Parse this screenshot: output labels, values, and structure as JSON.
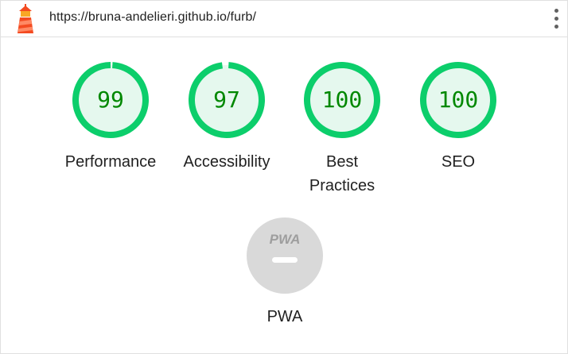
{
  "header": {
    "url": "https://bruna-andelieri.github.io/furb/",
    "logo_icon": "lighthouse-icon",
    "menu_icon": "kebab-menu-icon"
  },
  "colors": {
    "pass": "#0cce6b",
    "pass_fill": "#e5f8ee",
    "pass_text": "#008800",
    "pwa_gray": "#d9d9d9",
    "lighthouse_red": "#f44b21",
    "lighthouse_orange": "#f9a825"
  },
  "categories": [
    {
      "name": "performance",
      "score": "99",
      "value": 99,
      "label": "Performance"
    },
    {
      "name": "accessibility",
      "score": "97",
      "value": 97,
      "label": "Accessibility"
    },
    {
      "name": "best-practices",
      "score": "100",
      "value": 100,
      "label": "Best Practices"
    },
    {
      "name": "seo",
      "score": "100",
      "value": 100,
      "label": "SEO"
    }
  ],
  "pwa": {
    "badge": "PWA",
    "label": "PWA"
  }
}
